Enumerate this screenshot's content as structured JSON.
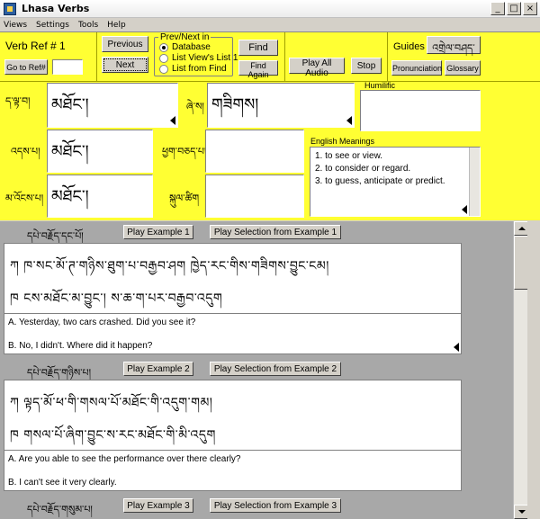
{
  "window": {
    "title": "Lhasa Verbs",
    "buttons": {
      "minimize": "_",
      "maximize": "□",
      "close": "×"
    }
  },
  "menu": [
    "Views",
    "Settings",
    "Tools",
    "Help"
  ],
  "toolbar": {
    "verb_ref_label": "Verb Ref # 1",
    "goto_ref_label": "Go to Ref#",
    "goto_ref_value": "",
    "previous_label": "Previous",
    "next_label": "Next",
    "prevnext_group_title": "Prev/Next in",
    "radio_options": [
      {
        "label": "Database",
        "selected": true
      },
      {
        "label": "List View's List 1",
        "selected": false
      },
      {
        "label": "List from Find",
        "selected": false
      }
    ],
    "find_label": "Find",
    "find_again_label": "Find Again",
    "play_all_label": "Play All Audio",
    "stop_label": "Stop",
    "guides_label": "Guides",
    "guides_tib_button": "འགྲེལ་བཤད་",
    "pronunciation_label": "Pronunciation",
    "glossary_label": "Glossary"
  },
  "verb_fields": {
    "present_label": "ད་ལྟ་བ།",
    "present_value": "མཐོང་།",
    "meaning_label": "ཞེ་ས།",
    "meaning_value": "གཟིགས།",
    "past_label": "འདས་པ།",
    "past_value": "མཐོང་།",
    "future_label": "མ་འོངས་པ།",
    "future_value": "མཐོང་།",
    "col2_label_a": "ཕྱག་བཅད་པ།",
    "col2_value_a": "",
    "col2_label_b": "སྐུལ་ཚིག",
    "col2_value_b": "",
    "humilific_label": "Humilific",
    "humilific_value": "",
    "english_label": "English Meanings",
    "english_meanings": [
      "1. to see or view.",
      "2. to consider or regard.",
      "3. to guess, anticipate or predict."
    ]
  },
  "examples": [
    {
      "header": "དཔེ་བརྗོད་དང་པོ།",
      "play_label": "Play Example 1",
      "play_sel_label": "Play Selection from Example 1",
      "tib_a": "ཀ  ཁ་སང་མོ་ཊ་གཉིས་ཐུག་པ་བརྒྱབ་ཤག  ཁྱེད་རང་གིས་གཟིགས་བྱུང་ངམ།",
      "tib_b": "ཁ  ངས་མཐོང་མ་བྱུང་།  ས་ཆ་ག་པར་བརྒྱབ་འདུག",
      "eng_a": "A. Yesterday, two cars crashed.  Did you see it?",
      "eng_b": "B. No, I didn't. Where did it happen?"
    },
    {
      "header": "དཔེ་བརྗོད་གཉིས་པ།",
      "play_label": "Play Example 2",
      "play_sel_label": "Play Selection from Example 2",
      "tib_a": "ཀ  ལྟད་མོ་ཕ་གི་གསལ་པོ་མཐོང་གི་འདུག་གམ།",
      "tib_b": "ཁ  གསལ་པོ་ཞིག་བྱུང་ས་རང་མཐོང་གི་མི་འདུག",
      "eng_a": "A. Are you able to see the performance over there clearly?",
      "eng_b": "B. I can't see it very clearly."
    },
    {
      "header": "དཔེ་བརྗོད་གསུམ་པ།",
      "play_label": "Play Example 3",
      "play_sel_label": "Play Selection from Example 3"
    }
  ]
}
